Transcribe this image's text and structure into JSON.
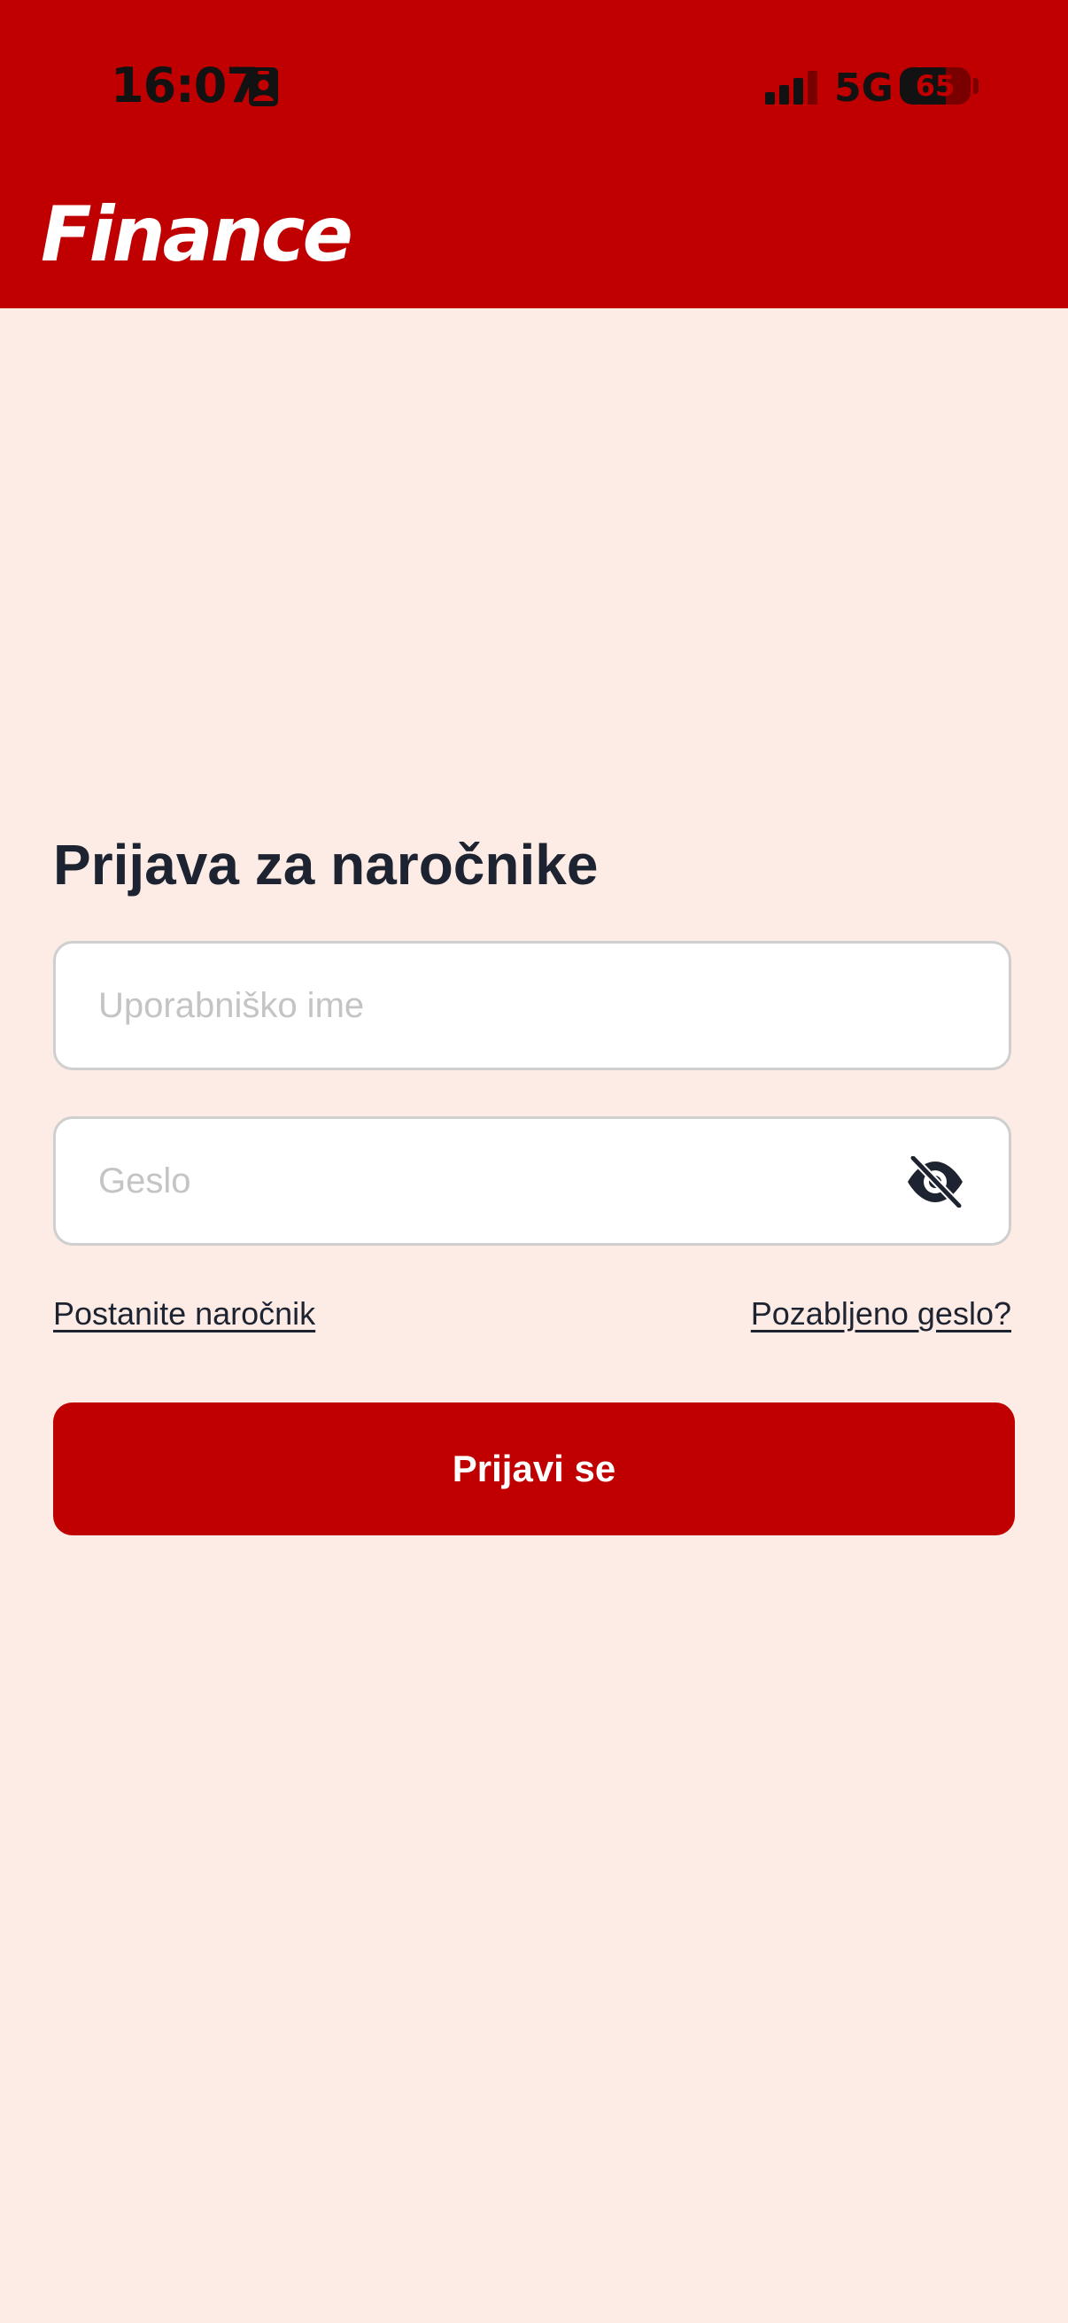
{
  "status_bar": {
    "time": "16:07",
    "network": "5G",
    "battery_level": "65",
    "battery_fraction": 0.65
  },
  "header": {
    "logo_text": "Finance"
  },
  "login": {
    "title": "Prijava za naročnike",
    "username_placeholder": "Uporabniško ime",
    "username_value": "",
    "password_placeholder": "Geslo",
    "password_value": "",
    "subscribe_link": "Postanite naročnik",
    "forgot_link": "Pozabljeno geslo?",
    "submit_label": "Prijavi se"
  },
  "icons": {
    "contact": "contact-card-icon",
    "signal": "cellular-signal-icon",
    "password_toggle": "eye-off-icon"
  },
  "colors": {
    "brand_red": "#c00000",
    "background": "#fdece5",
    "text_dark": "#1d2330",
    "placeholder": "#c4c4c4",
    "input_border": "#cfcfcf"
  }
}
